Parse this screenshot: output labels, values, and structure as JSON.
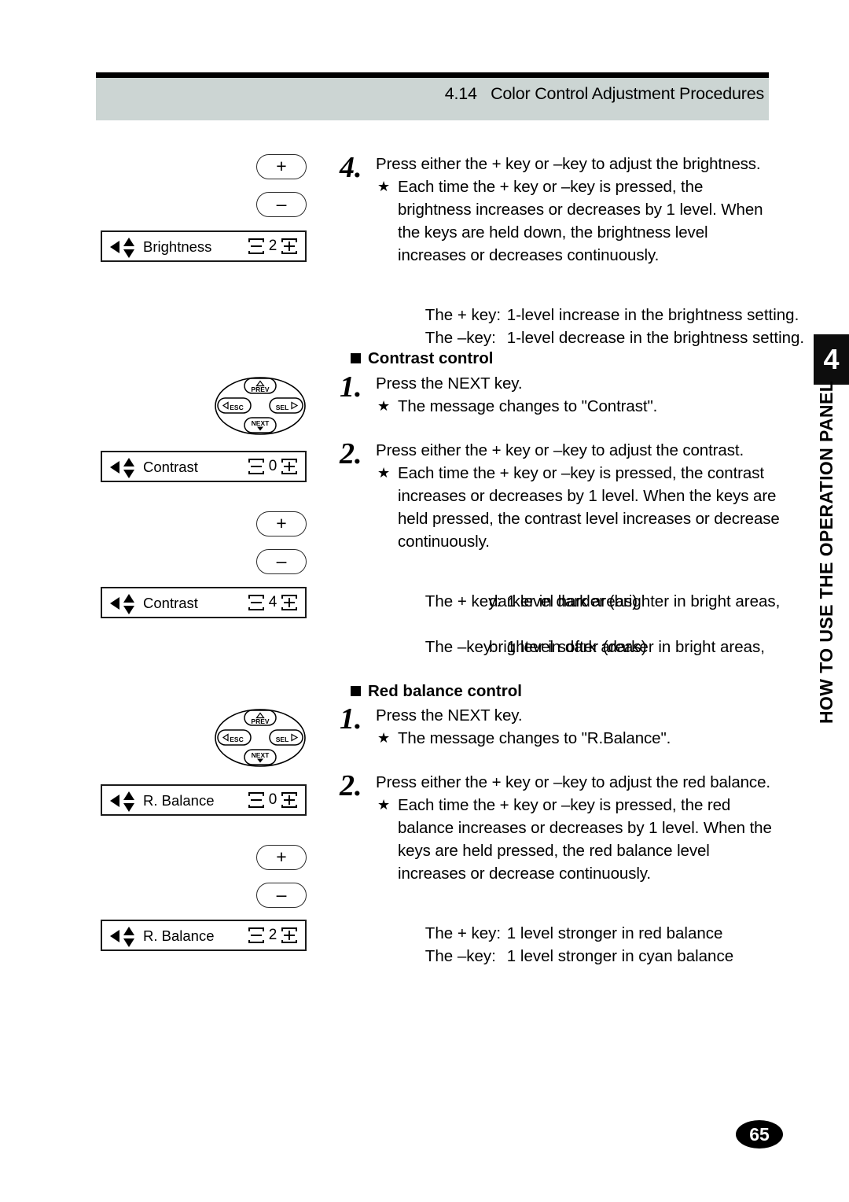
{
  "header": {
    "section_number": "4.14",
    "title": "Color Control Adjustment Procedures"
  },
  "chapter_tab": {
    "number": "4",
    "label": "HOW TO USE THE OPERATION PANEL"
  },
  "page_number": "65",
  "icons": {
    "plus_key": "+",
    "minus_key": "–",
    "star_bullet": "★"
  },
  "keypad": {
    "prev": "PREV",
    "esc": "ESC",
    "sel": "SEL",
    "next": "NEXT"
  },
  "panels": {
    "brightness_display": {
      "label": "Brightness",
      "value": "2"
    },
    "contrast_display_0": {
      "label": "Contrast",
      "value": "0"
    },
    "contrast_display_4": {
      "label": "Contrast",
      "value": "4"
    },
    "rbalance_display_0": {
      "label": "R. Balance",
      "value": "0"
    },
    "rbalance_display_2": {
      "label": "R. Balance",
      "value": "2"
    }
  },
  "brightness_step": {
    "number": "4.",
    "line1": "Press either the + key or –key to adjust the brightness.",
    "bullet1": "Each time the + key or –key is pressed, the brightness increases or decreases by 1 level.  When the keys are held down, the brightness level increases or decreases continuously.",
    "key_plus_label": "The + key:",
    "key_plus_desc": "1-level increase in the brightness setting.",
    "key_minus_label": "The –key:",
    "key_minus_desc": "1-level decrease in the brightness setting."
  },
  "contrast_section": {
    "heading": "Contrast control",
    "step1_number": "1.",
    "step1_line": "Press the NEXT key.",
    "step1_bullet": "The message changes to \"Contrast\".",
    "step2_number": "2.",
    "step2_line": "Press either the + key or –key to adjust the contrast.",
    "step2_bullet": "Each time the + key or –key is pressed, the contrast increases or decreases by 1 level.  When the keys are held pressed, the contrast level increases or decrease continuously.",
    "key_plus_label": "The + key:",
    "key_plus_desc": "1 level harder (brighter in bright areas,",
    "key_plus_desc2": "darker in dark areas)",
    "key_minus_label": "The –key:",
    "key_minus_desc": "1 level   softer (darker in bright areas,",
    "key_minus_desc2": "brighter in dark areas)"
  },
  "redbalance_section": {
    "heading": "Red balance control",
    "step1_number": "1.",
    "step1_line": "Press the NEXT key.",
    "step1_bullet": "The message changes to \"R.Balance\".",
    "step2_number": "2.",
    "step2_line": "Press either the + key or –key to adjust the red balance.",
    "step2_bullet": "Each time the + key or –key is pressed, the red balance increases or decreases by 1 level.  When the keys are held pressed, the red balance level increases or decrease continuously.",
    "key_plus_label": "The + key:",
    "key_plus_desc": "1 level stronger in red balance",
    "key_minus_label": "The –key:",
    "key_minus_desc": "1 level stronger in cyan balance"
  },
  "colors": {
    "header_band": "#ccd5d3",
    "ink": "#000000",
    "paper": "#ffffff"
  }
}
